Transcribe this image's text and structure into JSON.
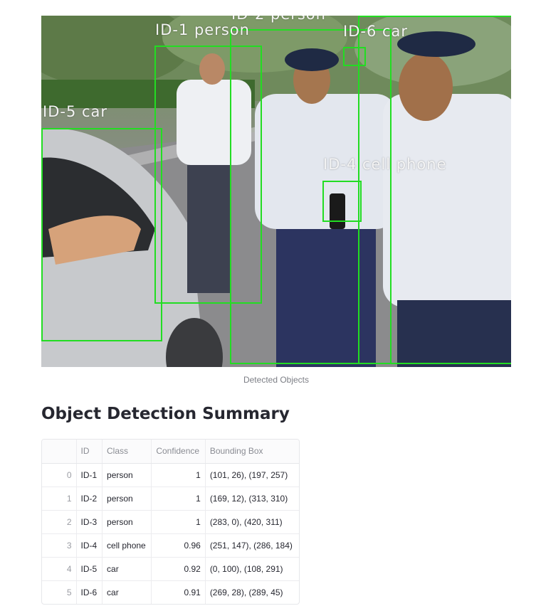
{
  "image": {
    "caption": "Detected Objects",
    "detections": [
      {
        "label": "ID-1 person"
      },
      {
        "label": "ID-2 person"
      },
      {
        "label": "ID-4 cell phone"
      },
      {
        "label": "ID-5 car"
      },
      {
        "label": "ID-6 car"
      }
    ]
  },
  "summary": {
    "title": "Object Detection Summary",
    "columns": [
      "",
      "ID",
      "Class",
      "Confidence",
      "Bounding Box"
    ],
    "rows": [
      {
        "index": "0",
        "id": "ID-1",
        "class": "person",
        "confidence": "1",
        "bbox": "(101, 26), (197, 257)"
      },
      {
        "index": "1",
        "id": "ID-2",
        "class": "person",
        "confidence": "1",
        "bbox": "(169, 12), (313, 310)"
      },
      {
        "index": "2",
        "id": "ID-3",
        "class": "person",
        "confidence": "1",
        "bbox": "(283, 0), (420, 311)"
      },
      {
        "index": "3",
        "id": "ID-4",
        "class": "cell phone",
        "confidence": "0.96",
        "bbox": "(251, 147), (286, 184)"
      },
      {
        "index": "4",
        "id": "ID-5",
        "class": "car",
        "confidence": "0.92",
        "bbox": "(0, 100), (108, 291)"
      },
      {
        "index": "5",
        "id": "ID-6",
        "class": "car",
        "confidence": "0.91",
        "bbox": "(269, 28), (289, 45)"
      }
    ]
  }
}
